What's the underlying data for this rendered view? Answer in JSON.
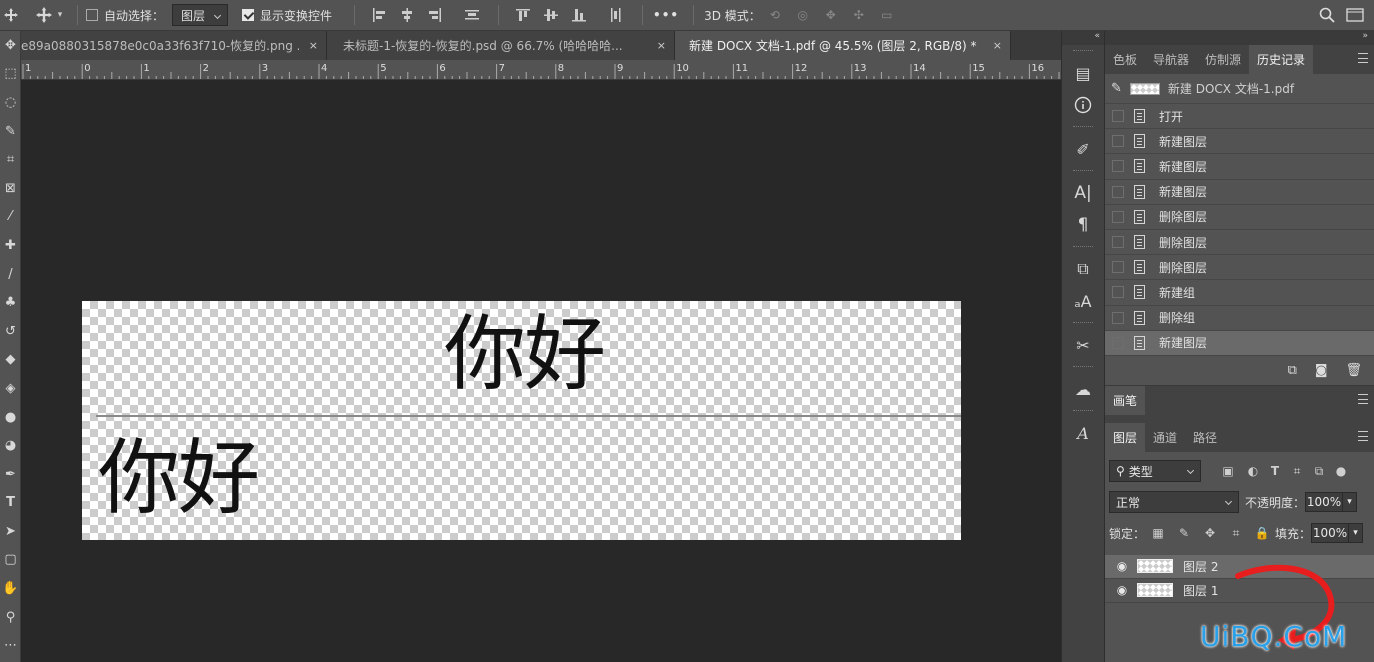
{
  "options_bar": {
    "auto_select_label": "自动选择：",
    "auto_select_checked": false,
    "auto_select_target": "图层",
    "show_transform_label": "显示变换控件",
    "show_transform_checked": true,
    "more_label": "•••",
    "mode_3d_label": "3D 模式："
  },
  "tabs": [
    {
      "label": "e89a0880315878e0c0a33f63f710-恢复的.png ...",
      "close": "×",
      "active": false
    },
    {
      "label": "未标题-1-恢复的-恢复的.psd @ 66.7% (哈哈哈哈...",
      "close": "×",
      "active": false
    },
    {
      "label": "新建 DOCX 文档-1.pdf @ 45.5% (图层 2, RGB/8) *",
      "close": "×",
      "active": true
    }
  ],
  "ruler": {
    "labels": [
      "1",
      "0",
      "1",
      "2",
      "3",
      "4",
      "5",
      "6",
      "7",
      "8",
      "9",
      "10",
      "11",
      "12",
      "13",
      "14",
      "15",
      "16"
    ]
  },
  "canvas": {
    "text_top": "你好",
    "text_bottom": "你好"
  },
  "history_panel": {
    "tabs": [
      "色板",
      "导航器",
      "仿制源",
      "历史记录"
    ],
    "active_tab": "历史记录",
    "source": "新建 DOCX 文档-1.pdf",
    "items": [
      "打开",
      "新建图层",
      "新建图层",
      "新建图层",
      "删除图层",
      "删除图层",
      "删除图层",
      "新建组",
      "删除组",
      "新建图层"
    ],
    "selected_index": 9
  },
  "brush_panel": {
    "tabs": [
      "画笔"
    ]
  },
  "layers_panel": {
    "tabs": [
      "图层",
      "通道",
      "路径"
    ],
    "active_tab": "图层",
    "filter_label": "类型",
    "blend_mode": "正常",
    "opacity_label": "不透明度：",
    "opacity_value": "100%",
    "lock_label": "锁定：",
    "fill_label": "填充：",
    "fill_value": "100%",
    "layers": [
      {
        "name": "图层 2",
        "selected": true
      },
      {
        "name": "图层 1",
        "selected": false
      }
    ]
  },
  "watermark": "UiBQ.CoM",
  "colors": {
    "accent_arrow": "#e81e1e",
    "watermark": "#2aa0e8"
  }
}
